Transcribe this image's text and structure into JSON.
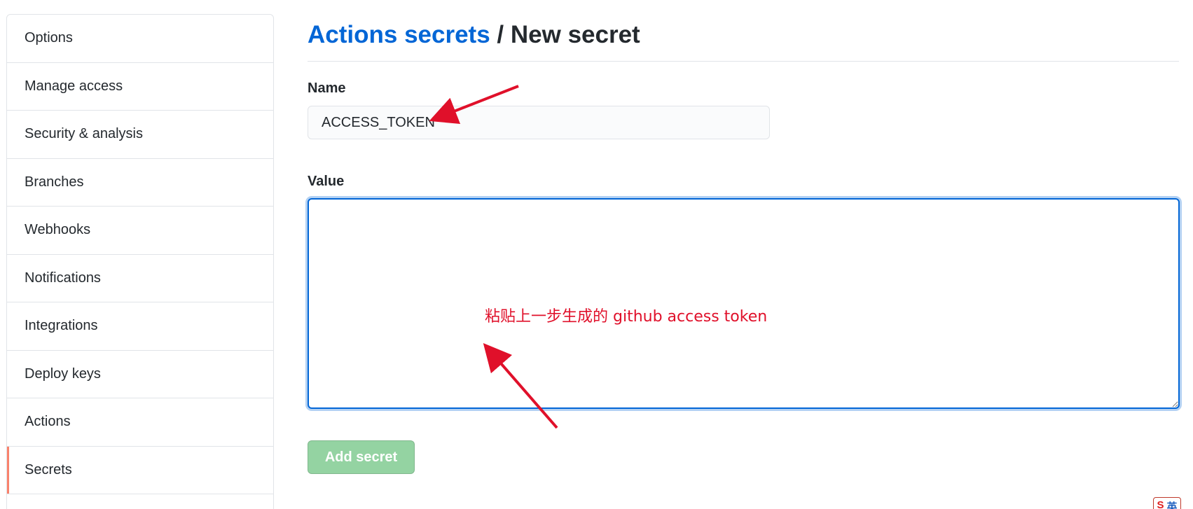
{
  "sidebar": {
    "items": [
      {
        "label": "Options"
      },
      {
        "label": "Manage access"
      },
      {
        "label": "Security & analysis"
      },
      {
        "label": "Branches"
      },
      {
        "label": "Webhooks"
      },
      {
        "label": "Notifications"
      },
      {
        "label": "Integrations"
      },
      {
        "label": "Deploy keys"
      },
      {
        "label": "Actions"
      },
      {
        "label": "Secrets"
      }
    ],
    "selected": "Secrets"
  },
  "header": {
    "breadcrumb_link": "Actions secrets",
    "separator": "/",
    "current": "New secret"
  },
  "form": {
    "name_label": "Name",
    "name_value": "ACCESS_TOKEN",
    "value_label": "Value",
    "value_value": "",
    "submit_label": "Add secret"
  },
  "annotation": {
    "text": "粘贴上一步生成的 github access token",
    "color": "#e0102a"
  },
  "ime_badge": {
    "brand": "S",
    "mode": "英"
  },
  "colors": {
    "link": "#0366d6",
    "selected_indicator": "#f9826c",
    "button_disabled_bg": "#94d3a2",
    "focus_border": "#0366d6"
  }
}
